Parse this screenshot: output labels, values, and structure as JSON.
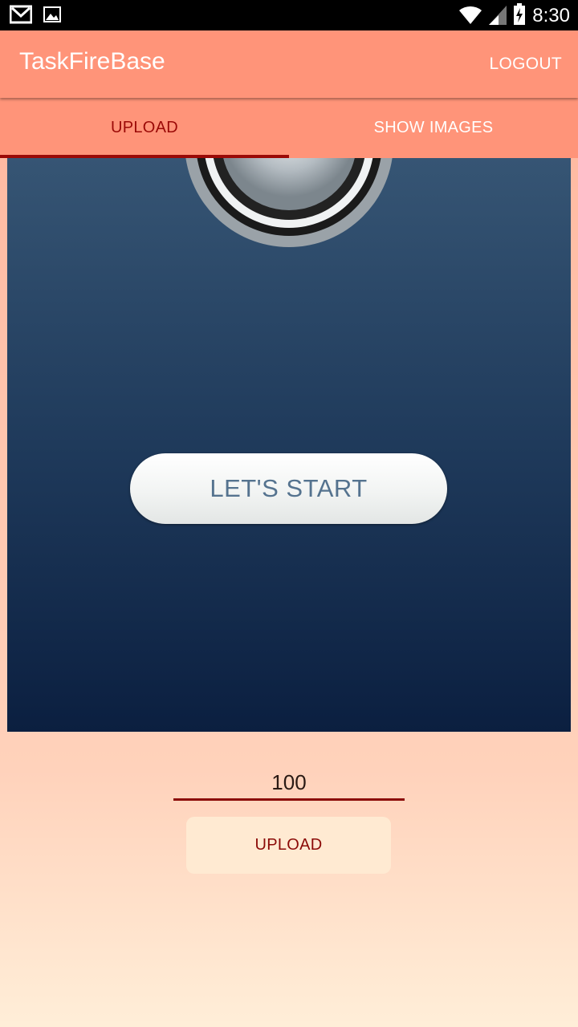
{
  "status_bar": {
    "time": "8:30",
    "left_icons": [
      "gmail-icon",
      "gallery-icon"
    ],
    "right_icons": [
      "wifi-icon",
      "signal-icon",
      "battery-charging-icon"
    ]
  },
  "app_bar": {
    "title": "TaskFireBase",
    "logout_label": "LOGOUT",
    "background_color": "#ff9479"
  },
  "tabs": [
    {
      "label": "UPLOAD",
      "selected": true,
      "color": "#9b0a07"
    },
    {
      "label": "SHOW IMAGES",
      "selected": false,
      "color": "#ffffff"
    }
  ],
  "image_preview": {
    "button_label": "LET'S START"
  },
  "form": {
    "number_value": "100",
    "upload_label": "UPLOAD",
    "accent_color": "#8b0a07"
  }
}
